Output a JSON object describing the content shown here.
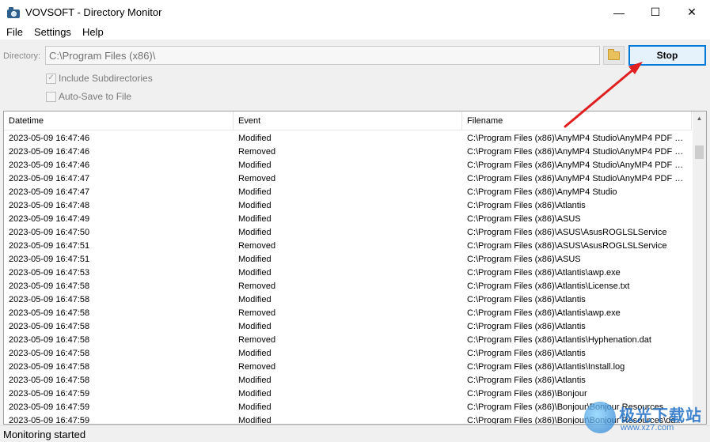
{
  "window": {
    "title": "VOVSOFT - Directory Monitor",
    "minimize_glyph": "—",
    "maximize_glyph": "☐",
    "close_glyph": "✕"
  },
  "menu": [
    "File",
    "Settings",
    "Help"
  ],
  "directory": {
    "label": "Directory:",
    "value": "C:\\Program Files (x86)\\"
  },
  "stop_label": "Stop",
  "options": {
    "include_subdirectories": {
      "label": "Include Subdirectories",
      "checked": true
    },
    "auto_save": {
      "label": "Auto-Save to File",
      "checked": false
    }
  },
  "table": {
    "columns": [
      "Datetime",
      "Event",
      "Filename"
    ],
    "rows": [
      [
        "2023-05-09 16:47:46",
        "Modified",
        "C:\\Program Files (x86)\\AnyMP4 Studio\\AnyMP4 PDF C..."
      ],
      [
        "2023-05-09 16:47:46",
        "Removed",
        "C:\\Program Files (x86)\\AnyMP4 Studio\\AnyMP4 PDF C..."
      ],
      [
        "2023-05-09 16:47:46",
        "Modified",
        "C:\\Program Files (x86)\\AnyMP4 Studio\\AnyMP4 PDF C..."
      ],
      [
        "2023-05-09 16:47:47",
        "Removed",
        "C:\\Program Files (x86)\\AnyMP4 Studio\\AnyMP4 PDF C..."
      ],
      [
        "2023-05-09 16:47:47",
        "Modified",
        "C:\\Program Files (x86)\\AnyMP4 Studio"
      ],
      [
        "2023-05-09 16:47:48",
        "Modified",
        "C:\\Program Files (x86)\\Atlantis"
      ],
      [
        "2023-05-09 16:47:49",
        "Modified",
        "C:\\Program Files (x86)\\ASUS"
      ],
      [
        "2023-05-09 16:47:50",
        "Modified",
        "C:\\Program Files (x86)\\ASUS\\AsusROGLSLService"
      ],
      [
        "2023-05-09 16:47:51",
        "Removed",
        "C:\\Program Files (x86)\\ASUS\\AsusROGLSLService"
      ],
      [
        "2023-05-09 16:47:51",
        "Modified",
        "C:\\Program Files (x86)\\ASUS"
      ],
      [
        "2023-05-09 16:47:53",
        "Modified",
        "C:\\Program Files (x86)\\Atlantis\\awp.exe"
      ],
      [
        "2023-05-09 16:47:58",
        "Removed",
        "C:\\Program Files (x86)\\Atlantis\\License.txt"
      ],
      [
        "2023-05-09 16:47:58",
        "Modified",
        "C:\\Program Files (x86)\\Atlantis"
      ],
      [
        "2023-05-09 16:47:58",
        "Removed",
        "C:\\Program Files (x86)\\Atlantis\\awp.exe"
      ],
      [
        "2023-05-09 16:47:58",
        "Modified",
        "C:\\Program Files (x86)\\Atlantis"
      ],
      [
        "2023-05-09 16:47:58",
        "Removed",
        "C:\\Program Files (x86)\\Atlantis\\Hyphenation.dat"
      ],
      [
        "2023-05-09 16:47:58",
        "Modified",
        "C:\\Program Files (x86)\\Atlantis"
      ],
      [
        "2023-05-09 16:47:58",
        "Removed",
        "C:\\Program Files (x86)\\Atlantis\\Install.log"
      ],
      [
        "2023-05-09 16:47:58",
        "Modified",
        "C:\\Program Files (x86)\\Atlantis"
      ],
      [
        "2023-05-09 16:47:59",
        "Modified",
        "C:\\Program Files (x86)\\Bonjour"
      ],
      [
        "2023-05-09 16:47:59",
        "Modified",
        "C:\\Program Files (x86)\\Bonjour\\Bonjour Resources"
      ],
      [
        "2023-05-09 16:47:59",
        "Modified",
        "C:\\Program Files (x86)\\Bonjour\\Bonjour Resources\\da..."
      ]
    ]
  },
  "status": "Monitoring started",
  "watermark": {
    "text": "极光下载站",
    "url": "www.xz7.com"
  },
  "colors": {
    "accent": "#0078d7",
    "annotation_arrow": "#e02020"
  }
}
